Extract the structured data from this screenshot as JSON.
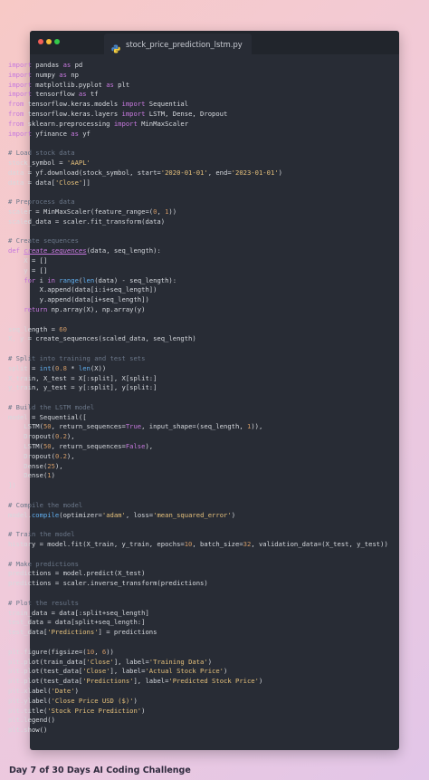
{
  "window": {
    "tab_title": "stock_price_prediction_lstm.py"
  },
  "code_lines": [
    [
      [
        "kw",
        "import"
      ],
      [
        "t",
        " pandas "
      ],
      [
        "kw",
        "as"
      ],
      [
        "t",
        " pd"
      ]
    ],
    [
      [
        "kw",
        "import"
      ],
      [
        "t",
        " numpy "
      ],
      [
        "kw",
        "as"
      ],
      [
        "t",
        " np"
      ]
    ],
    [
      [
        "kw",
        "import"
      ],
      [
        "t",
        " matplotlib.pyplot "
      ],
      [
        "kw",
        "as"
      ],
      [
        "t",
        " plt"
      ]
    ],
    [
      [
        "kw",
        "import"
      ],
      [
        "t",
        " tensorflow "
      ],
      [
        "kw",
        "as"
      ],
      [
        "t",
        " tf"
      ]
    ],
    [
      [
        "kw",
        "from"
      ],
      [
        "t",
        " tensorflow.keras.models "
      ],
      [
        "kw",
        "import"
      ],
      [
        "t",
        " Sequential"
      ]
    ],
    [
      [
        "kw",
        "from"
      ],
      [
        "t",
        " tensorflow.keras.layers "
      ],
      [
        "kw",
        "import"
      ],
      [
        "t",
        " LSTM, Dense, Dropout"
      ]
    ],
    [
      [
        "kw",
        "from"
      ],
      [
        "t",
        " sklearn.preprocessing "
      ],
      [
        "kw",
        "import"
      ],
      [
        "t",
        " MinMaxScaler"
      ]
    ],
    [
      [
        "kw",
        "import"
      ],
      [
        "t",
        " yfinance "
      ],
      [
        "kw",
        "as"
      ],
      [
        "t",
        " yf"
      ]
    ],
    [],
    [
      [
        "cm",
        "# Load stock data"
      ]
    ],
    [
      [
        "t",
        "stock_symbol = "
      ],
      [
        "str",
        "'AAPL'"
      ]
    ],
    [
      [
        "t",
        "data = yf.download(stock_symbol, start="
      ],
      [
        "str",
        "'2020-01-01'"
      ],
      [
        "t",
        ", end="
      ],
      [
        "str",
        "'2023-01-01'"
      ],
      [
        "t",
        ")"
      ]
    ],
    [
      [
        "t",
        "data = data["
      ],
      [
        "str",
        "'Close'"
      ],
      [
        "t",
        "]]"
      ]
    ],
    [],
    [
      [
        "cm",
        "# Preprocess data"
      ]
    ],
    [
      [
        "t",
        "scaler = MinMaxScaler(feature_range=("
      ],
      [
        "num",
        "0"
      ],
      [
        "t",
        ", "
      ],
      [
        "num",
        "1"
      ],
      [
        "t",
        "))"
      ]
    ],
    [
      [
        "t",
        "scaled_data = scaler.fit_transform(data)"
      ]
    ],
    [],
    [
      [
        "cm",
        "# Create sequences"
      ]
    ],
    [
      [
        "kw",
        "def"
      ],
      [
        "t",
        " "
      ],
      [
        "fn",
        "create_sequences"
      ],
      [
        "t",
        "(data, seq_length):"
      ]
    ],
    [
      [
        "t",
        "    X = []"
      ]
    ],
    [
      [
        "t",
        "    y = []"
      ]
    ],
    [
      [
        "t",
        "    "
      ],
      [
        "kw",
        "for"
      ],
      [
        "t",
        " i "
      ],
      [
        "kw",
        "in"
      ],
      [
        "t",
        " "
      ],
      [
        "bi",
        "range"
      ],
      [
        "t",
        "("
      ],
      [
        "bi",
        "len"
      ],
      [
        "t",
        "(data) - seq_length):"
      ]
    ],
    [
      [
        "t",
        "        X.append(data[i:i+seq_length])"
      ]
    ],
    [
      [
        "t",
        "        y.append(data[i+seq_length])"
      ]
    ],
    [
      [
        "t",
        "    "
      ],
      [
        "kw",
        "return"
      ],
      [
        "t",
        " np.array(X), np.array(y)"
      ]
    ],
    [],
    [
      [
        "t",
        "seq_length = "
      ],
      [
        "num",
        "60"
      ]
    ],
    [
      [
        "t",
        "X, y = create_sequences(scaled_data, seq_length)"
      ]
    ],
    [],
    [
      [
        "cm",
        "# Split into training and test sets"
      ]
    ],
    [
      [
        "t",
        "split = "
      ],
      [
        "bi",
        "int"
      ],
      [
        "t",
        "("
      ],
      [
        "num",
        "0.8"
      ],
      [
        "t",
        " * "
      ],
      [
        "bi",
        "len"
      ],
      [
        "t",
        "(X))"
      ]
    ],
    [
      [
        "t",
        "X_train, X_test = X[:split], X[split:]"
      ]
    ],
    [
      [
        "t",
        "y_train, y_test = y[:split], y[split:]"
      ]
    ],
    [],
    [
      [
        "cm",
        "# Build the LSTM model"
      ]
    ],
    [
      [
        "t",
        "model = Sequential(["
      ]
    ],
    [
      [
        "t",
        "    LSTM("
      ],
      [
        "num",
        "50"
      ],
      [
        "t",
        ", return_sequences="
      ],
      [
        "kw",
        "True"
      ],
      [
        "t",
        ", input_shape=(seq_length, "
      ],
      [
        "num",
        "1"
      ],
      [
        "t",
        ")),"
      ]
    ],
    [
      [
        "t",
        "    Dropout("
      ],
      [
        "num",
        "0.2"
      ],
      [
        "t",
        "),"
      ]
    ],
    [
      [
        "t",
        "    LSTM("
      ],
      [
        "num",
        "50"
      ],
      [
        "t",
        ", return_sequences="
      ],
      [
        "kw",
        "False"
      ],
      [
        "t",
        "),"
      ]
    ],
    [
      [
        "t",
        "    Dropout("
      ],
      [
        "num",
        "0.2"
      ],
      [
        "t",
        "),"
      ]
    ],
    [
      [
        "t",
        "    Dense("
      ],
      [
        "num",
        "25"
      ],
      [
        "t",
        "),"
      ]
    ],
    [
      [
        "t",
        "    Dense("
      ],
      [
        "num",
        "1"
      ],
      [
        "t",
        ")"
      ]
    ],
    [
      [
        "t",
        "])"
      ]
    ],
    [],
    [
      [
        "cm",
        "# Compile the model"
      ]
    ],
    [
      [
        "t",
        "model."
      ],
      [
        "bi",
        "compile"
      ],
      [
        "t",
        "(optimizer="
      ],
      [
        "str",
        "'adam'"
      ],
      [
        "t",
        ", loss="
      ],
      [
        "str",
        "'mean_squared_error'"
      ],
      [
        "t",
        ")"
      ]
    ],
    [],
    [
      [
        "cm",
        "# Train the model"
      ]
    ],
    [
      [
        "t",
        "history = model.fit(X_train, y_train, epochs="
      ],
      [
        "num",
        "10"
      ],
      [
        "t",
        ", batch_size="
      ],
      [
        "num",
        "32"
      ],
      [
        "t",
        ", validation_data=(X_test, y_test))"
      ]
    ],
    [],
    [
      [
        "cm",
        "# Make predictions"
      ]
    ],
    [
      [
        "t",
        "predictions = model.predict(X_test)"
      ]
    ],
    [
      [
        "t",
        "predictions = scaler.inverse_transform(predictions)"
      ]
    ],
    [],
    [
      [
        "cm",
        "# Plot the results"
      ]
    ],
    [
      [
        "t",
        "train_data = data[:split+seq_length]"
      ]
    ],
    [
      [
        "t",
        "test_data = data[split+seq_length:]"
      ]
    ],
    [
      [
        "t",
        "test_data["
      ],
      [
        "str",
        "'Predictions'"
      ],
      [
        "t",
        "] = predictions"
      ]
    ],
    [],
    [
      [
        "t",
        "plt.figure(figsize=("
      ],
      [
        "num",
        "10"
      ],
      [
        "t",
        ", "
      ],
      [
        "num",
        "6"
      ],
      [
        "t",
        "))"
      ]
    ],
    [
      [
        "t",
        "plt.plot(train_data["
      ],
      [
        "str",
        "'Close'"
      ],
      [
        "t",
        "], label="
      ],
      [
        "str",
        "'Training Data'"
      ],
      [
        "t",
        ")"
      ]
    ],
    [
      [
        "t",
        "plt.plot(test_data["
      ],
      [
        "str",
        "'Close'"
      ],
      [
        "t",
        "], label="
      ],
      [
        "str",
        "'Actual Stock Price'"
      ],
      [
        "t",
        ")"
      ]
    ],
    [
      [
        "t",
        "plt.plot(test_data["
      ],
      [
        "str",
        "'Predictions'"
      ],
      [
        "t",
        "], label="
      ],
      [
        "str",
        "'Predicted Stock Price'"
      ],
      [
        "t",
        ")"
      ]
    ],
    [
      [
        "t",
        "plt.xlabel("
      ],
      [
        "str",
        "'Date'"
      ],
      [
        "t",
        ")"
      ]
    ],
    [
      [
        "t",
        "plt.ylabel("
      ],
      [
        "str",
        "'Close Price USD ($)'"
      ],
      [
        "t",
        ")"
      ]
    ],
    [
      [
        "t",
        "plt.title("
      ],
      [
        "str",
        "'Stock Price Prediction'"
      ],
      [
        "t",
        ")"
      ]
    ],
    [
      [
        "t",
        "plt.legend()"
      ]
    ],
    [
      [
        "t",
        "plt.show()"
      ]
    ]
  ],
  "footer": {
    "caption": "Day 7 of 30 Days AI Coding Challenge"
  }
}
